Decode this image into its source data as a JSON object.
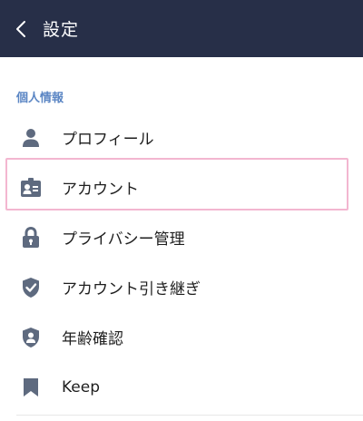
{
  "header": {
    "title": "設定",
    "back_icon": "chevron-left-icon",
    "background": "#272f48"
  },
  "section": {
    "label": "個人情報",
    "label_color": "#5b86c4"
  },
  "items": [
    {
      "label": "プロフィール",
      "icon": "person-icon"
    },
    {
      "label": "アカウント",
      "icon": "id-card-icon",
      "selected": true
    },
    {
      "label": "プライバシー管理",
      "icon": "lock-icon"
    },
    {
      "label": "アカウント引き継ぎ",
      "icon": "shield-check-icon"
    },
    {
      "label": "年齢確認",
      "icon": "shield-person-icon"
    },
    {
      "label": "Keep",
      "icon": "bookmark-icon"
    }
  ],
  "highlight_color": "#f3b6d0"
}
